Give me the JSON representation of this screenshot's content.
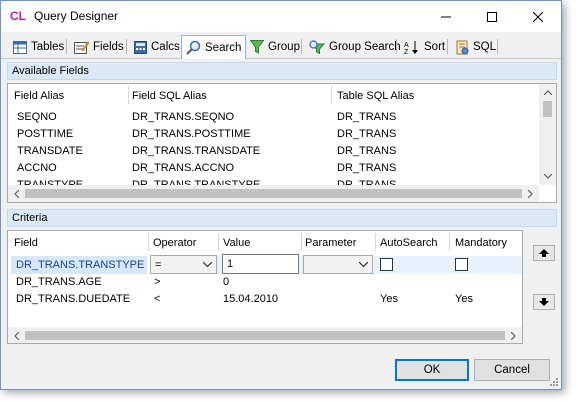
{
  "window": {
    "logo": "CL",
    "title": "Query Designer"
  },
  "tabs": [
    {
      "label": "Tables",
      "icon": "table-icon"
    },
    {
      "label": "Fields",
      "icon": "fields-icon"
    },
    {
      "label": "Calcs",
      "icon": "calculator-icon"
    },
    {
      "label": "Search",
      "icon": "magnifier-icon",
      "active": true
    },
    {
      "label": "Group",
      "icon": "funnel-icon"
    },
    {
      "label": "Group Search",
      "icon": "funnel-search-icon"
    },
    {
      "label": "Sort",
      "icon": "sort-az-icon"
    },
    {
      "label": "SQL",
      "icon": "sql-script-icon"
    }
  ],
  "available_fields": {
    "header": "Available Fields",
    "columns": [
      "Field Alias",
      "Field SQL Alias",
      "Table SQL Alias"
    ],
    "rows": [
      [
        "SEQNO",
        "DR_TRANS.SEQNO",
        "DR_TRANS"
      ],
      [
        "POSTTIME",
        "DR_TRANS.POSTTIME",
        "DR_TRANS"
      ],
      [
        "TRANSDATE",
        "DR_TRANS.TRANSDATE",
        "DR_TRANS"
      ],
      [
        "ACCNO",
        "DR_TRANS.ACCNO",
        "DR_TRANS"
      ],
      [
        "TRANSTYPE",
        "DR_TRANS.TRANSTYPE",
        "DR_TRANS"
      ]
    ]
  },
  "criteria": {
    "header": "Criteria",
    "columns": [
      "Field",
      "Operator",
      "Value",
      "Parameter",
      "AutoSearch",
      "Mandatory"
    ],
    "rows": [
      {
        "field": "DR_TRANS.TRANSTYPE",
        "operator": "=",
        "value": "1",
        "parameter": "",
        "autosearch": "",
        "mandatory": ""
      },
      {
        "field": "DR_TRANS.AGE",
        "operator": ">",
        "value": "0",
        "parameter": "",
        "autosearch": "",
        "mandatory": ""
      },
      {
        "field": "DR_TRANS.DUEDATE",
        "operator": "<",
        "value": "15.04.2010",
        "parameter": "",
        "autosearch": "Yes",
        "mandatory": "Yes"
      }
    ]
  },
  "buttons": {
    "ok": "OK",
    "cancel": "Cancel"
  },
  "colors": {
    "accent": "#0078d7",
    "logo": "#c41ab3",
    "section_header": "#dbe9f7"
  }
}
